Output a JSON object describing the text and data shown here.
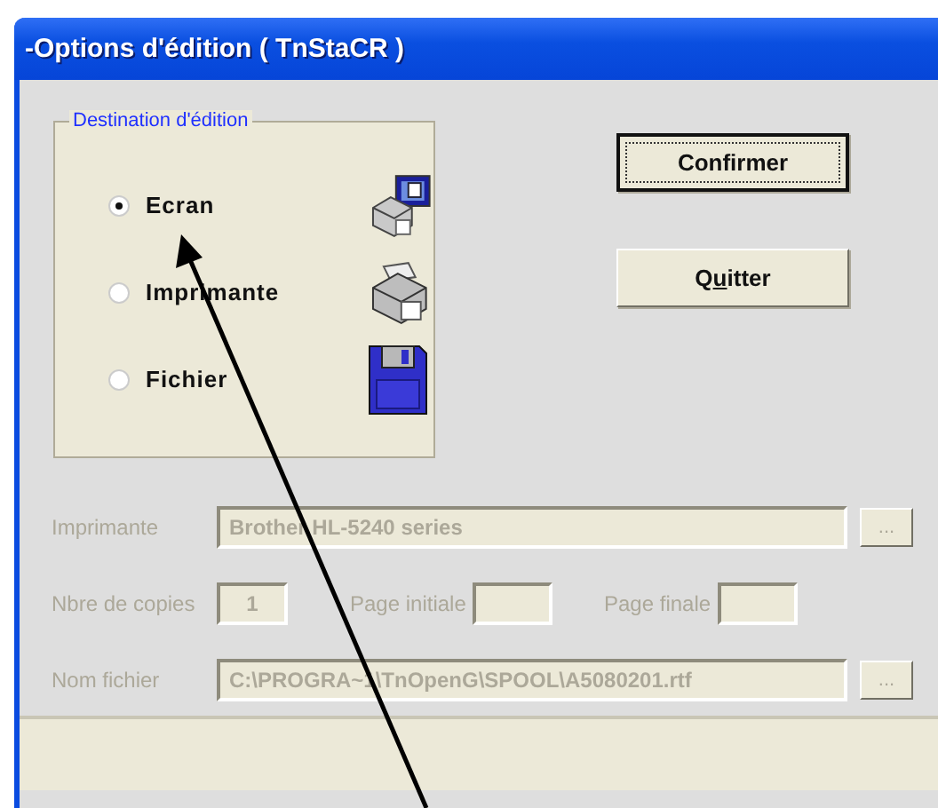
{
  "window": {
    "title": "-Options d'édition ( TnStaCR )"
  },
  "destination": {
    "legend": "Destination d'édition",
    "options": [
      {
        "label": "Ecran",
        "selected": true
      },
      {
        "label": "Imprimante",
        "selected": false
      },
      {
        "label": "Fichier",
        "selected": false
      }
    ]
  },
  "buttons": [
    {
      "label_parts": [
        {
          "text": "Confirmer",
          "underlined": false
        }
      ],
      "default": true
    },
    {
      "label_parts": [
        {
          "text": "Q",
          "underlined": false
        },
        {
          "text": "u",
          "underlined": true
        },
        {
          "text": "itter",
          "underlined": false
        }
      ],
      "default": false
    }
  ],
  "printer_row": {
    "label": "Imprimante",
    "value": "Brother HL-5240 series",
    "disabled": true,
    "browse": "..."
  },
  "copies_row": [
    {
      "label": "Nbre de copies",
      "value": "1",
      "disabled": true
    },
    {
      "label": "Page initiale",
      "disabled": true
    },
    {
      "label": "Page finale",
      "disabled": true
    }
  ],
  "file_row": {
    "label": "Nom fichier",
    "value": "C:\\PROGRA~1\\TnOpenG\\SPOOL\\A5080201.rtf",
    "disabled": true,
    "browse": "..."
  }
}
